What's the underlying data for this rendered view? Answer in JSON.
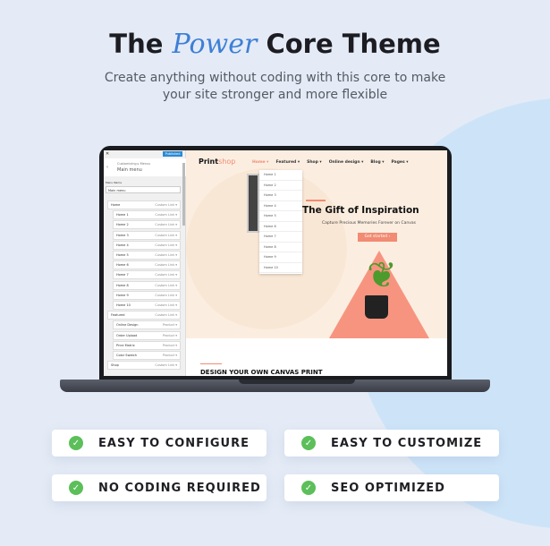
{
  "header": {
    "title_pre": "The",
    "title_script": "Power",
    "title_post": "Core Theme",
    "subtitle_line1": "Create anything without coding with this core to make",
    "subtitle_line2": "your site stronger and more flexible"
  },
  "customizer": {
    "publish_label": "Published",
    "breadcrumb": "Customizing ▸ Menus",
    "panel_title": "Main menu",
    "menu_name_label": "Menu Name",
    "menu_name_value": "Main menu",
    "items": [
      {
        "label": "Home",
        "type": "Custom Link",
        "level": 0
      },
      {
        "label": "Home 1",
        "type": "Custom Link",
        "level": 1
      },
      {
        "label": "Home 2",
        "type": "Custom Link",
        "level": 1
      },
      {
        "label": "Home 3",
        "type": "Custom Link",
        "level": 1
      },
      {
        "label": "Home 4",
        "type": "Custom Link",
        "level": 1
      },
      {
        "label": "Home 5",
        "type": "Custom Link",
        "level": 1
      },
      {
        "label": "Home 6",
        "type": "Custom Link",
        "level": 1
      },
      {
        "label": "Home 7",
        "type": "Custom Link",
        "level": 1
      },
      {
        "label": "Home 8",
        "type": "Custom Link",
        "level": 1
      },
      {
        "label": "Home 9",
        "type": "Custom Link",
        "level": 1
      },
      {
        "label": "Home 10",
        "type": "Custom Link",
        "level": 1
      },
      {
        "label": "Featured",
        "type": "Custom Link",
        "level": 0
      },
      {
        "label": "Online Design",
        "type": "Product",
        "level": 1
      },
      {
        "label": "Order Upload",
        "type": "Product",
        "level": 1
      },
      {
        "label": "Price Matrix",
        "type": "Product",
        "level": 1
      },
      {
        "label": "Color Swatch",
        "type": "Product",
        "level": 1
      },
      {
        "label": "Shop",
        "type": "Custom Link",
        "level": 0
      }
    ]
  },
  "site": {
    "logo_a": "Print",
    "logo_b": "shop",
    "nav": [
      "Home",
      "Featured",
      "Shop",
      "Online design",
      "Blog",
      "Pages"
    ],
    "dropdown": [
      "Home 1",
      "Home 2",
      "Home 3",
      "Home 4",
      "Home 5",
      "Home 6",
      "Home 7",
      "Home 8",
      "Home 9",
      "Home 10"
    ],
    "hero_title": "The Gift of Inspiration",
    "hero_sub": "Capture Precious Memories Forever on Canvas",
    "cta": "Get started ›",
    "section_title": "DESIGN YOUR OWN CANVAS PRINT"
  },
  "features": [
    "EASY TO CONFIGURE",
    "EASY TO CUSTOMIZE",
    "NO CODING REQUIRED",
    "SEO OPTIMIZED"
  ],
  "colors": {
    "accent": "#f28b73",
    "check": "#5cbf5a",
    "script": "#3e7fd6"
  }
}
